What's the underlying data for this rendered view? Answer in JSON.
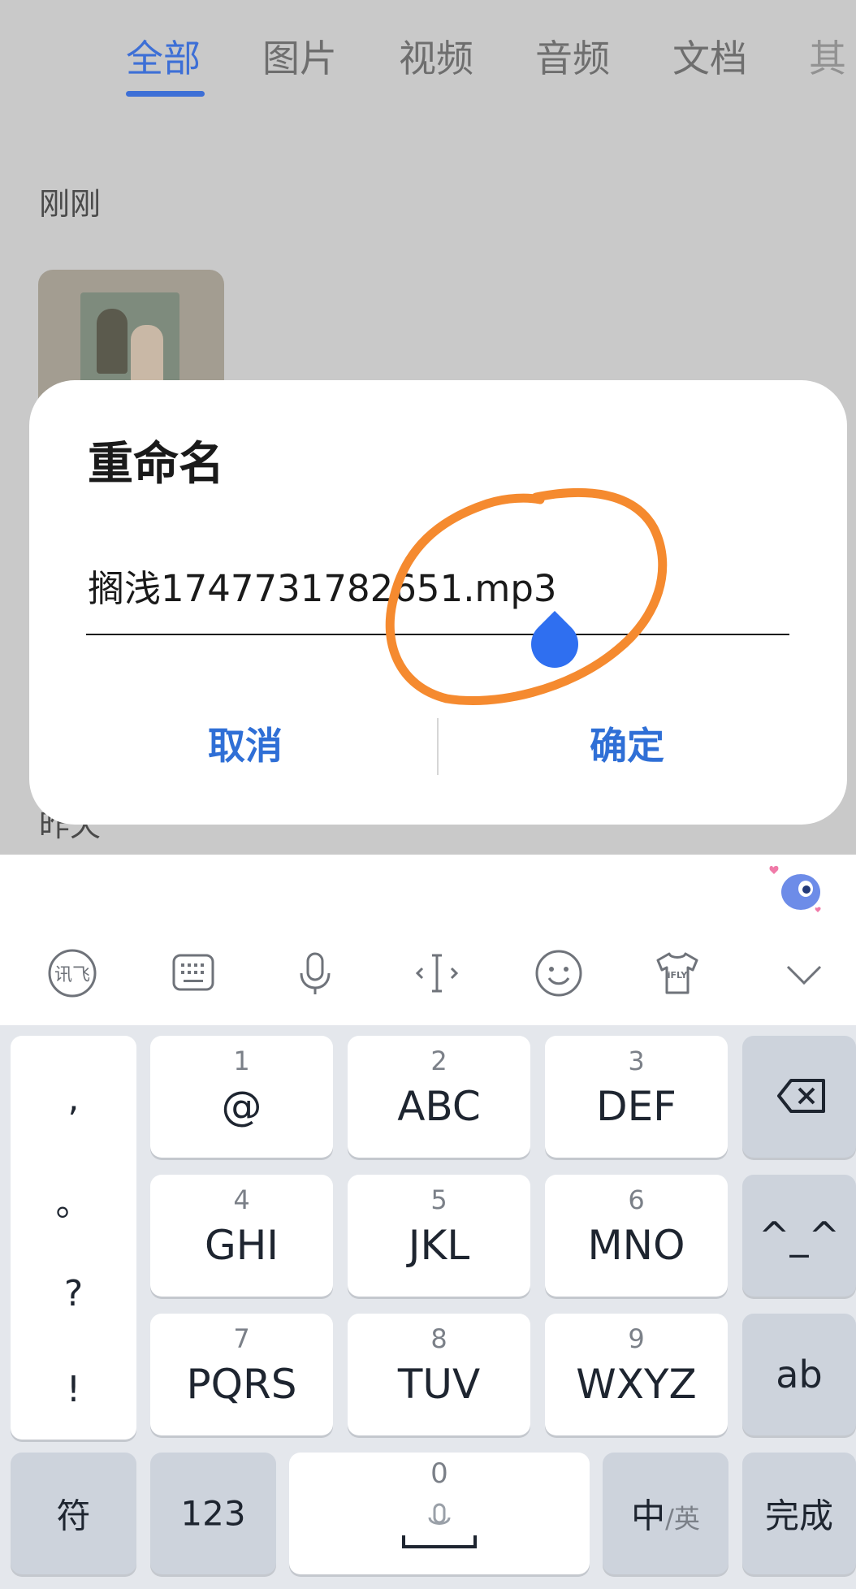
{
  "tabs": [
    {
      "label": "全部",
      "active": true
    },
    {
      "label": "图片",
      "active": false
    },
    {
      "label": "视频",
      "active": false
    },
    {
      "label": "音频",
      "active": false
    },
    {
      "label": "文档",
      "active": false
    },
    {
      "label": "其",
      "active": false
    }
  ],
  "sections": {
    "just_now": "刚刚",
    "yesterday": "昨天"
  },
  "dialog": {
    "title": "重命名",
    "filename": "搁浅1747731782651.mp3",
    "cancel": "取消",
    "confirm": "确定"
  },
  "keyboard": {
    "toolbar_icons": [
      "ifly-logo-icon",
      "keyboard-icon",
      "microphone-icon",
      "cursor-icon",
      "emoji-icon",
      "tshirt-skin-icon",
      "chevron-down-icon"
    ],
    "toolbar_skin_text": "iFLY",
    "toolbar_logo_text": "讯飞",
    "punctuation": [
      ",",
      "。",
      "?",
      "!"
    ],
    "keys": [
      {
        "num": "1",
        "letters": "@"
      },
      {
        "num": "2",
        "letters": "ABC"
      },
      {
        "num": "3",
        "letters": "DEF"
      },
      {
        "num": "4",
        "letters": "GHI"
      },
      {
        "num": "5",
        "letters": "JKL"
      },
      {
        "num": "6",
        "letters": "MNO"
      },
      {
        "num": "7",
        "letters": "PQRS"
      },
      {
        "num": "8",
        "letters": "TUV"
      },
      {
        "num": "9",
        "letters": "WXYZ"
      }
    ],
    "right_keys": {
      "backspace": "backspace-icon",
      "emoticon": "^_^",
      "ab": "ab"
    },
    "bottom": {
      "symbols": "符",
      "numbers": "123",
      "space_zero": "0",
      "lang_zh": "中",
      "lang_en": "/英",
      "done": "完成"
    }
  },
  "colors": {
    "accent": "#2f6fd6",
    "annotation": "#f58a2f",
    "handle": "#2f6ff0"
  }
}
